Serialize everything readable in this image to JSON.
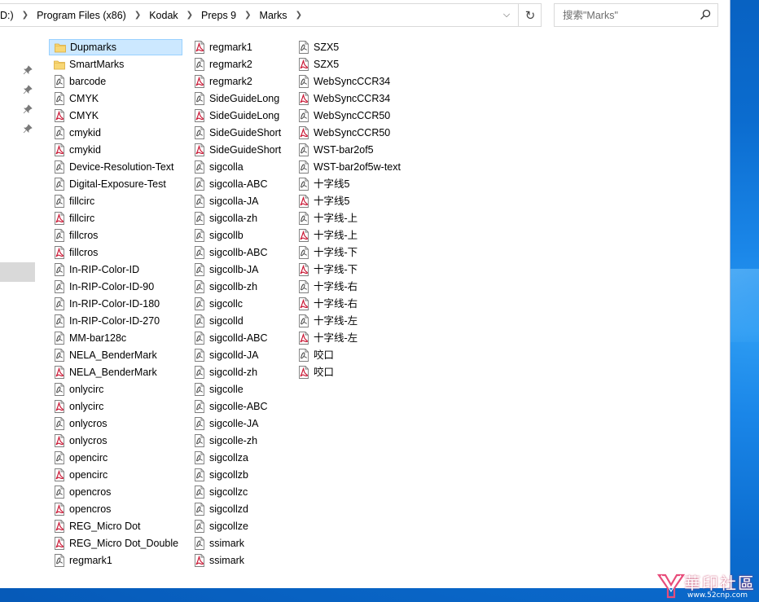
{
  "address": {
    "crumbs": [
      "D:)",
      "Program Files (x86)",
      "Kodak",
      "Preps 9",
      "Marks"
    ]
  },
  "search": {
    "placeholder": "搜索\"Marks\""
  },
  "columns": [
    [
      {
        "name": "Dupmarks",
        "type": "folder",
        "selected": true
      },
      {
        "name": "SmartMarks",
        "type": "folder"
      },
      {
        "name": "barcode",
        "type": "mark"
      },
      {
        "name": "CMYK",
        "type": "mark"
      },
      {
        "name": "CMYK",
        "type": "pdf"
      },
      {
        "name": "cmykid",
        "type": "mark"
      },
      {
        "name": "cmykid",
        "type": "pdf"
      },
      {
        "name": "Device-Resolution-Text",
        "type": "mark"
      },
      {
        "name": "Digital-Exposure-Test",
        "type": "mark"
      },
      {
        "name": "fillcirc",
        "type": "mark"
      },
      {
        "name": "fillcirc",
        "type": "pdf"
      },
      {
        "name": "fillcros",
        "type": "mark"
      },
      {
        "name": "fillcros",
        "type": "pdf"
      },
      {
        "name": "In-RIP-Color-ID",
        "type": "mark"
      },
      {
        "name": "In-RIP-Color-ID-90",
        "type": "mark"
      },
      {
        "name": "In-RIP-Color-ID-180",
        "type": "mark"
      },
      {
        "name": "In-RIP-Color-ID-270",
        "type": "mark"
      },
      {
        "name": "MM-bar128c",
        "type": "mark"
      },
      {
        "name": "NELA_BenderMark",
        "type": "mark"
      },
      {
        "name": "NELA_BenderMark",
        "type": "pdf"
      },
      {
        "name": "onlycirc",
        "type": "mark"
      },
      {
        "name": "onlycirc",
        "type": "pdf"
      },
      {
        "name": "onlycros",
        "type": "mark"
      },
      {
        "name": "onlycros",
        "type": "pdf"
      },
      {
        "name": "opencirc",
        "type": "mark"
      },
      {
        "name": "opencirc",
        "type": "pdf"
      },
      {
        "name": "opencros",
        "type": "mark"
      },
      {
        "name": "opencros",
        "type": "pdf"
      },
      {
        "name": "REG_Micro Dot",
        "type": "pdf"
      },
      {
        "name": "REG_Micro Dot_Double",
        "type": "pdf"
      },
      {
        "name": "regmark1",
        "type": "mark"
      }
    ],
    [
      {
        "name": "regmark1",
        "type": "pdf"
      },
      {
        "name": "regmark2",
        "type": "mark"
      },
      {
        "name": "regmark2",
        "type": "pdf"
      },
      {
        "name": "SideGuideLong",
        "type": "mark"
      },
      {
        "name": "SideGuideLong",
        "type": "pdf"
      },
      {
        "name": "SideGuideShort",
        "type": "mark"
      },
      {
        "name": "SideGuideShort",
        "type": "pdf"
      },
      {
        "name": "sigcolla",
        "type": "mark"
      },
      {
        "name": "sigcolla-ABC",
        "type": "mark"
      },
      {
        "name": "sigcolla-JA",
        "type": "mark"
      },
      {
        "name": "sigcolla-zh",
        "type": "mark"
      },
      {
        "name": "sigcollb",
        "type": "mark"
      },
      {
        "name": "sigcollb-ABC",
        "type": "mark"
      },
      {
        "name": "sigcollb-JA",
        "type": "mark"
      },
      {
        "name": "sigcollb-zh",
        "type": "mark"
      },
      {
        "name": "sigcollc",
        "type": "mark"
      },
      {
        "name": "sigcolld",
        "type": "mark"
      },
      {
        "name": "sigcolld-ABC",
        "type": "mark"
      },
      {
        "name": "sigcolld-JA",
        "type": "mark"
      },
      {
        "name": "sigcolld-zh",
        "type": "mark"
      },
      {
        "name": "sigcolle",
        "type": "mark"
      },
      {
        "name": "sigcolle-ABC",
        "type": "mark"
      },
      {
        "name": "sigcolle-JA",
        "type": "mark"
      },
      {
        "name": "sigcolle-zh",
        "type": "mark"
      },
      {
        "name": "sigcollza",
        "type": "mark"
      },
      {
        "name": "sigcollzb",
        "type": "mark"
      },
      {
        "name": "sigcollzc",
        "type": "mark"
      },
      {
        "name": "sigcollzd",
        "type": "mark"
      },
      {
        "name": "sigcollze",
        "type": "mark"
      },
      {
        "name": "ssimark",
        "type": "mark"
      },
      {
        "name": "ssimark",
        "type": "pdf"
      }
    ],
    [
      {
        "name": "SZX5",
        "type": "mark"
      },
      {
        "name": "SZX5",
        "type": "pdf"
      },
      {
        "name": "WebSyncCCR34",
        "type": "mark"
      },
      {
        "name": "WebSyncCCR34",
        "type": "pdf"
      },
      {
        "name": "WebSyncCCR50",
        "type": "mark"
      },
      {
        "name": "WebSyncCCR50",
        "type": "pdf"
      },
      {
        "name": "WST-bar2of5",
        "type": "mark"
      },
      {
        "name": "WST-bar2of5w-text",
        "type": "mark"
      },
      {
        "name": "十字线5",
        "type": "mark"
      },
      {
        "name": "十字线5",
        "type": "pdf"
      },
      {
        "name": "十字线-上",
        "type": "mark"
      },
      {
        "name": "十字线-上",
        "type": "pdf"
      },
      {
        "name": "十字线-下",
        "type": "mark"
      },
      {
        "name": "十字线-下",
        "type": "pdf"
      },
      {
        "name": "十字线-右",
        "type": "mark"
      },
      {
        "name": "十字线-右",
        "type": "pdf"
      },
      {
        "name": "十字线-左",
        "type": "mark"
      },
      {
        "name": "十字线-左",
        "type": "pdf"
      },
      {
        "name": "咬口",
        "type": "mark"
      },
      {
        "name": "咬口",
        "type": "pdf"
      }
    ]
  ],
  "watermark": {
    "text": "華印社區",
    "url": "www.52cnp.com"
  },
  "colors": {
    "pdf": "#c8102e",
    "folder": "#f8d775",
    "selection": "#cce8ff"
  }
}
